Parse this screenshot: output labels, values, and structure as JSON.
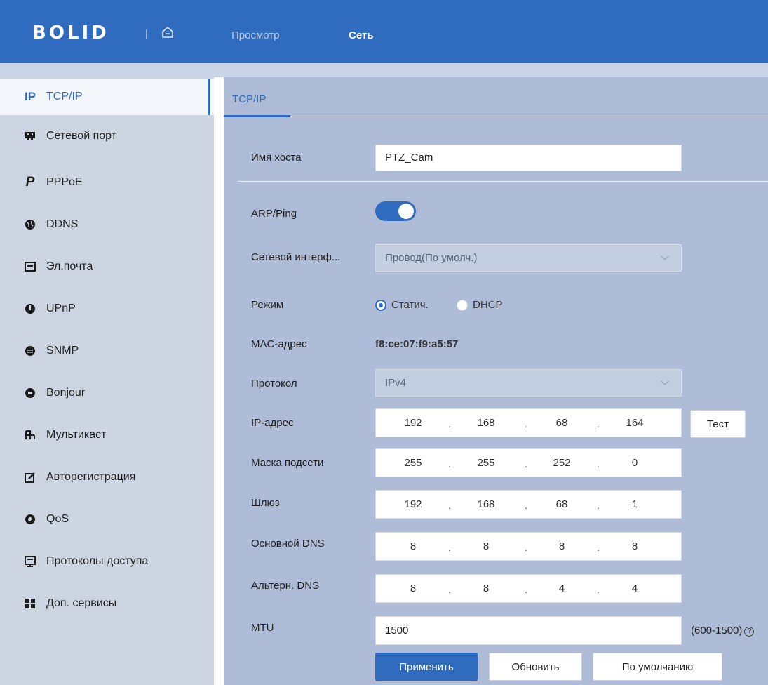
{
  "header": {
    "logo": "BOLID",
    "tabs": [
      {
        "label": "Просмотр"
      },
      {
        "label": "Сеть"
      }
    ]
  },
  "sidebar": {
    "items": [
      {
        "label": "TCP/IP",
        "icon": "ip-icon",
        "glyph": "IP",
        "active": true
      },
      {
        "label": "Сетевой порт",
        "icon": "network-port-icon",
        "glyph": "▀"
      },
      {
        "label": "PPPoE",
        "icon": "pppoe-icon",
        "glyph": "P"
      },
      {
        "label": "DDNS",
        "icon": "globe-icon",
        "glyph": "⊕"
      },
      {
        "label": "Эл.почта",
        "icon": "email-icon",
        "glyph": "⊡"
      },
      {
        "label": "UPnP",
        "icon": "upnp-icon",
        "glyph": "◍"
      },
      {
        "label": "SNMP",
        "icon": "snmp-icon",
        "glyph": "●"
      },
      {
        "label": "Bonjour",
        "icon": "bonjour-icon",
        "glyph": "●"
      },
      {
        "label": "Мультикаст",
        "icon": "multicast-icon",
        "glyph": "╬"
      },
      {
        "label": "Авторегистрация",
        "icon": "auto-register-icon",
        "glyph": "✎"
      },
      {
        "label": "QoS",
        "icon": "qos-icon",
        "glyph": "◉"
      },
      {
        "label": "Протоколы доступа",
        "icon": "access-protocols-icon",
        "glyph": "⊟"
      },
      {
        "label": "Доп. сервисы",
        "icon": "extra-services-icon",
        "glyph": "■"
      }
    ]
  },
  "main": {
    "tab": "TCP/IP",
    "hostname": {
      "label": "Имя хоста",
      "value": "PTZ_Cam"
    },
    "arp_ping": {
      "label": "ARP/Ping",
      "enabled": true
    },
    "interface": {
      "label": "Сетевой интерф...",
      "value": "Провод(По умолч.)"
    },
    "mode": {
      "label": "Режим",
      "options": [
        "Статич.",
        "DHCP"
      ],
      "selected": "Статич."
    },
    "mac": {
      "label": "MAC-адрес",
      "value": "f8:ce:07:f9:a5:57"
    },
    "protocol": {
      "label": "Протокол",
      "value": "IPv4"
    },
    "ip": {
      "label": "IP-адрес",
      "octets": [
        "192",
        "168",
        "68",
        "164"
      ],
      "test_label": "Тест"
    },
    "mask": {
      "label": "Маска подсети",
      "octets": [
        "255",
        "255",
        "252",
        "0"
      ]
    },
    "gateway": {
      "label": "Шлюз",
      "octets": [
        "192",
        "168",
        "68",
        "1"
      ]
    },
    "dns1": {
      "label": "Основной DNS",
      "octets": [
        "8",
        "8",
        "8",
        "8"
      ]
    },
    "dns2": {
      "label": "Альтерн. DNS",
      "octets": [
        "8",
        "8",
        "4",
        "4"
      ]
    },
    "mtu": {
      "label": "MTU",
      "value": "1500",
      "range": "(600-1500)"
    },
    "buttons": {
      "apply": "Применить",
      "refresh": "Обновить",
      "default": "По умолчанию"
    }
  },
  "colors": {
    "accent": "#2f6cc0",
    "sidebar_bg": "#cdd4e2",
    "main_bg": "#aebcd7"
  }
}
